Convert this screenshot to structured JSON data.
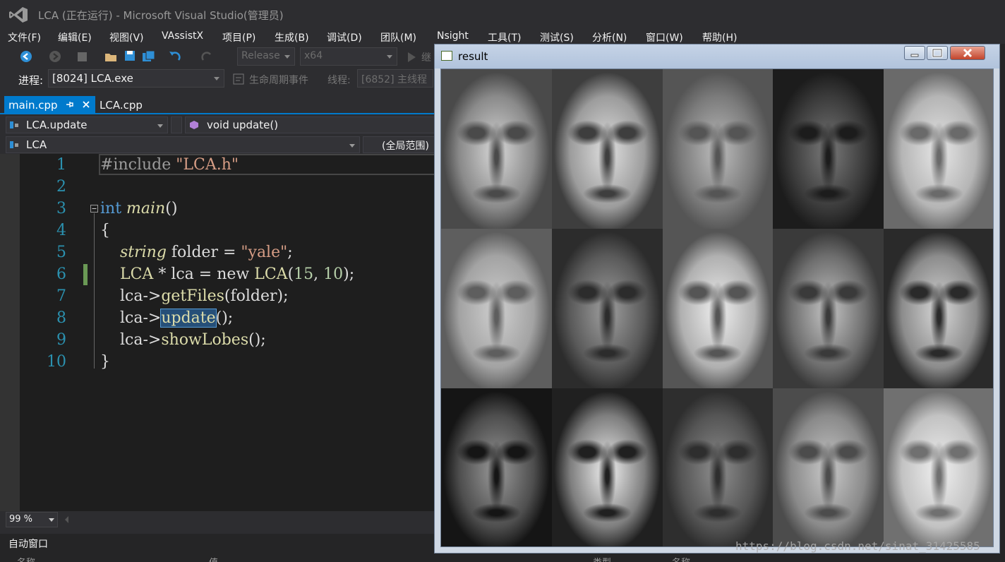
{
  "window": {
    "title": "LCA (正在运行) - Microsoft Visual Studio(管理员)"
  },
  "menu": [
    "文件(F)",
    "编辑(E)",
    "视图(V)",
    "VAssistX",
    "项目(P)",
    "生成(B)",
    "调试(D)",
    "团队(M)",
    "Nsight",
    "工具(T)",
    "测试(S)",
    "分析(N)",
    "窗口(W)",
    "帮助(H)"
  ],
  "toolbar": {
    "config": "Release",
    "platform": "x64",
    "continue_label": "继",
    "process_label": "进程:",
    "process_value": "[8024] LCA.exe",
    "lifecycle_label": "生命周期事件",
    "thread_label": "线程:",
    "thread_value": "[6852] 主线程"
  },
  "tabs": [
    {
      "label": "main.cpp",
      "active": true
    },
    {
      "label": "LCA.cpp",
      "active": false
    }
  ],
  "nav": {
    "member": "LCA.update",
    "function": "void update()",
    "scope_class": "LCA",
    "scope": "(全局范围)"
  },
  "code": {
    "line_numbers": [
      "1",
      "2",
      "3",
      "4",
      "5",
      "6",
      "7",
      "8",
      "9",
      "10"
    ]
  },
  "zoom": "99 %",
  "bottom_panel": {
    "title": "自动窗口",
    "col_name": "名称",
    "col_value": "值",
    "col_type": "类型",
    "col_name2": "名称"
  },
  "result_window": {
    "title": "result"
  },
  "faces": {
    "rows": 3,
    "cols": 5
  },
  "watermark": "https://blog.csdn.net/sinat_31425585"
}
